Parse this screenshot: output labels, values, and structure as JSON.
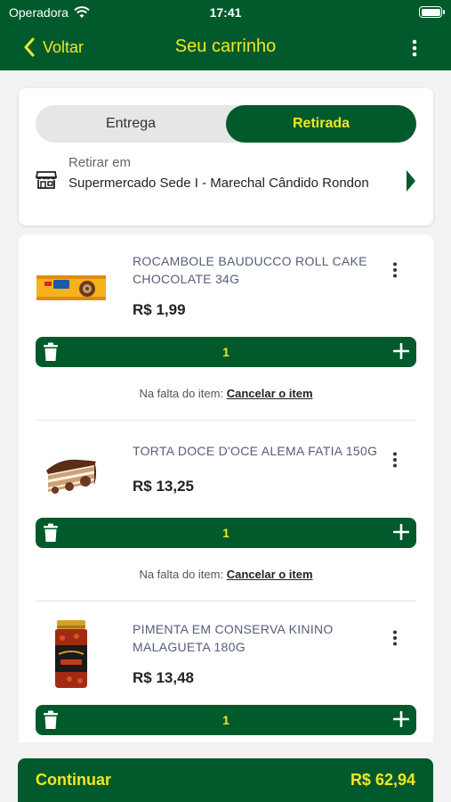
{
  "status_bar": {
    "carrier": "Operadora",
    "time": "17:41"
  },
  "nav": {
    "back_label": "Voltar",
    "title": "Seu carrinho"
  },
  "delivery": {
    "options": [
      "Entrega",
      "Retirada"
    ],
    "selected": "Retirada",
    "pickup_label": "Retirar em",
    "store_name": "Supermercado Sede I - Marechal Cândido Rondon"
  },
  "cart": {
    "items": [
      {
        "name": "ROCAMBOLE BAUDUCCO ROLL CAKE CHOCOLATE 34G",
        "price": "R$ 1,99",
        "qty": "1",
        "missing_label": "Na falta do item:",
        "missing_action": "Cancelar o item"
      },
      {
        "name": "TORTA DOCE D'OCE ALEMA FATIA 150G",
        "price": "R$ 13,25",
        "qty": "1",
        "missing_label": "Na falta do item:",
        "missing_action": "Cancelar o item"
      },
      {
        "name": "PIMENTA EM CONSERVA KININO MALAGUETA 180G",
        "price": "R$ 13,48",
        "qty": "1"
      }
    ]
  },
  "footer": {
    "continue_label": "Continuar",
    "total": "R$ 62,94"
  },
  "colors": {
    "brand_green": "#005a2b",
    "accent_yellow": "#f3e626"
  }
}
